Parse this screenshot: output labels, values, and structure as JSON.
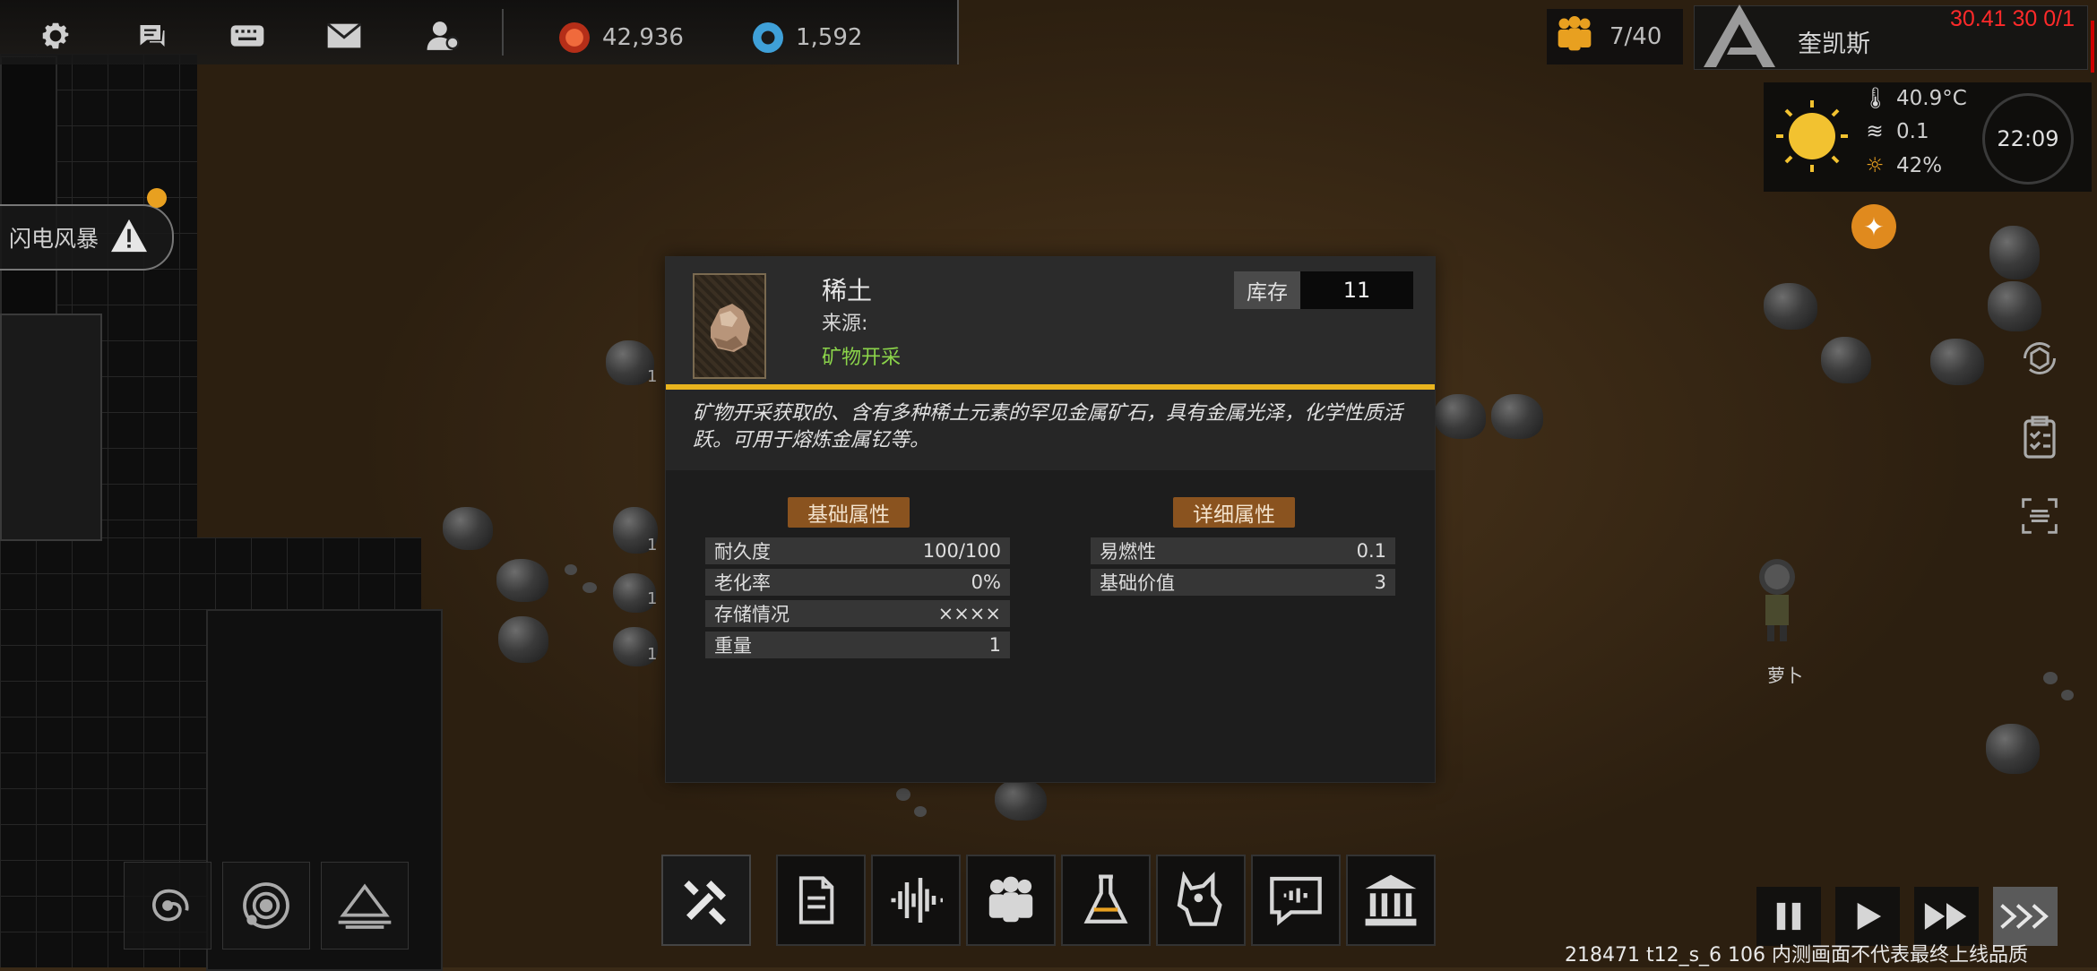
{
  "topbar": {
    "icons": [
      "gear-icon",
      "chat-icon",
      "keyboard-icon",
      "mail-icon",
      "person-icon"
    ],
    "resources": [
      {
        "name": "red-coin",
        "value": "42,936",
        "color": "#d9462a"
      },
      {
        "name": "blue-coin",
        "value": "1,592",
        "color": "#3fa0d8"
      }
    ],
    "population": "7/40",
    "colony_name": "奎凯斯",
    "debug": "30.41 30 0/1"
  },
  "weather": {
    "temperature": "40.9°C",
    "wind": "0.1",
    "humidity": "42%",
    "time": "22:09"
  },
  "alert": {
    "label": "闪电风暴"
  },
  "modal": {
    "item_name": "稀土",
    "source_label": "来源:",
    "source": "矿物开采",
    "stock_label": "库存",
    "stock_value": "11",
    "description": "矿物开采获取的、含有多种稀土元素的罕见金属矿石，具有金属光泽，化学性质活跃。可用于熔炼金属钇等。",
    "basic_header": "基础属性",
    "detail_header": "详细属性",
    "basic": [
      {
        "label": "耐久度",
        "value": "100/100"
      },
      {
        "label": "老化率",
        "value": "0%"
      },
      {
        "label": "存储情况",
        "value": "××××"
      },
      {
        "label": "重量",
        "value": "1"
      }
    ],
    "detail": [
      {
        "label": "易燃性",
        "value": "0.1"
      },
      {
        "label": "基础价值",
        "value": "3"
      }
    ]
  },
  "map_labels": {
    "npc_name": "萝卜",
    "row_numbers": [
      "1",
      "1",
      "1",
      "1"
    ]
  },
  "bottom_tabs": [
    "build-hammer-icon",
    "blueprint-icon",
    "audio-wave-icon",
    "colonists-icon",
    "research-flask-icon",
    "animal-icon",
    "message-icon",
    "government-icon"
  ],
  "left_tools": [
    "galaxy-icon",
    "planet-orbit-icon",
    "terrain-icon"
  ],
  "speed_controls": [
    "pause-icon",
    "play-icon",
    "fast-forward-icon",
    "ultra-fast-icon"
  ],
  "footer": "218471 t12_s_6 106  内测画面不代表最终上线品质"
}
